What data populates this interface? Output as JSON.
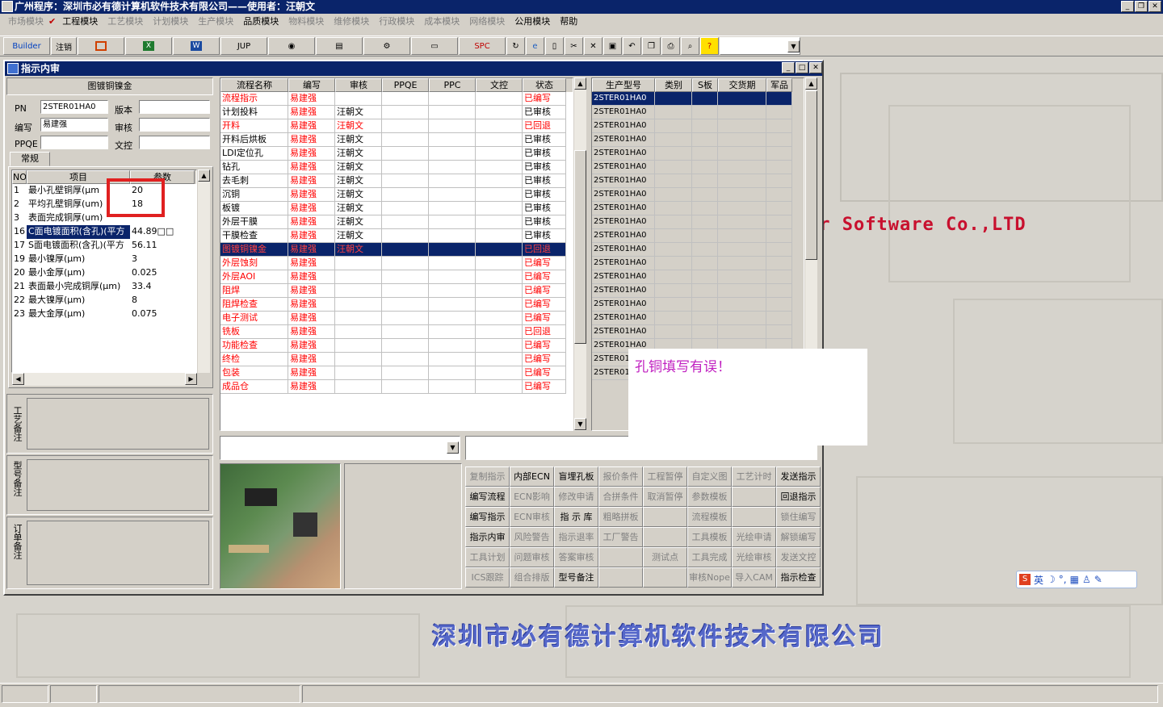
{
  "app": {
    "title": "广州程序：深圳市必有德计算机软件技术有限公司——使用者：汪朝文"
  },
  "menu": [
    {
      "label": "市场模块",
      "enabled": false
    },
    {
      "label": "工程模块",
      "enabled": true,
      "checked": true
    },
    {
      "label": "工艺模块",
      "enabled": false
    },
    {
      "label": "计划模块",
      "enabled": false
    },
    {
      "label": "生产模块",
      "enabled": false
    },
    {
      "label": "品质模块",
      "enabled": true
    },
    {
      "label": "物料模块",
      "enabled": false
    },
    {
      "label": "维修模块",
      "enabled": false
    },
    {
      "label": "行政模块",
      "enabled": false
    },
    {
      "label": "成本模块",
      "enabled": false
    },
    {
      "label": "网络模块",
      "enabled": false
    },
    {
      "label": "公用模块",
      "enabled": true
    },
    {
      "label": "帮助",
      "enabled": true
    }
  ],
  "toolbar": {
    "builder": "Builder",
    "logout": "注销",
    "jup": "JUP",
    "spc": "SPC"
  },
  "window": {
    "title": "指示内审"
  },
  "left": {
    "section_title": "图镀铜镍金",
    "pn_label": "PN",
    "pn_value": "2STER01HA0",
    "version_label": "版本",
    "version_value": "",
    "author_label": "编写",
    "author_value": "易建强",
    "review_label": "审核",
    "review_value": "",
    "ppqe_label": "PPQE",
    "ppqe_value": "",
    "wenkong_label": "文控",
    "wenkong_value": "",
    "tab": "常规",
    "param_headers": [
      "NO",
      "项目",
      "参数"
    ],
    "params": [
      [
        "1",
        "最小孔壁铜厚(μm",
        "20"
      ],
      [
        "2",
        "平均孔壁铜厚(um)",
        "18"
      ],
      [
        "3",
        "表面完成铜厚(um)",
        ""
      ],
      [
        "16",
        "C面电镀面积(含孔)(平方",
        "44.89□□"
      ],
      [
        "17",
        "S面电镀面积(含孔)(平方",
        "56.11"
      ],
      [
        "19",
        "最小镍厚(μm)",
        "3"
      ],
      [
        "20",
        "最小金厚(μm)",
        "0.025"
      ],
      [
        "21",
        "表面最小完成铜厚(μm)",
        "33.4"
      ],
      [
        "22",
        "最大镍厚(μm)",
        "8"
      ],
      [
        "23",
        "最大金厚(μm)",
        "0.075"
      ]
    ],
    "notes": [
      "工艺备注",
      "型号备注",
      "订单备注"
    ]
  },
  "flow": {
    "headers": [
      "流程名称",
      "编写",
      "审核",
      "PPQE",
      "PPC",
      "文控",
      "状态"
    ],
    "rows": [
      [
        "流程指示",
        "易建强",
        "",
        "",
        "",
        "",
        "已编写",
        "r"
      ],
      [
        "计划投料",
        "易建强",
        "汪朝文",
        "",
        "",
        "",
        "已审核",
        ""
      ],
      [
        "开料",
        "易建强",
        "汪朝文",
        "",
        "",
        "",
        "已回退",
        "r"
      ],
      [
        "开料后烘板",
        "易建强",
        "汪朝文",
        "",
        "",
        "",
        "已审核",
        ""
      ],
      [
        "LDI定位孔",
        "易建强",
        "汪朝文",
        "",
        "",
        "",
        "已审核",
        ""
      ],
      [
        "钻孔",
        "易建强",
        "汪朝文",
        "",
        "",
        "",
        "已审核",
        ""
      ],
      [
        "去毛刺",
        "易建强",
        "汪朝文",
        "",
        "",
        "",
        "已审核",
        ""
      ],
      [
        "沉铜",
        "易建强",
        "汪朝文",
        "",
        "",
        "",
        "已审核",
        ""
      ],
      [
        "板镀",
        "易建强",
        "汪朝文",
        "",
        "",
        "",
        "已审核",
        ""
      ],
      [
        "外层干膜",
        "易建强",
        "汪朝文",
        "",
        "",
        "",
        "已审核",
        ""
      ],
      [
        "干膜检查",
        "易建强",
        "汪朝文",
        "",
        "",
        "",
        "已审核",
        ""
      ],
      [
        "图镀铜镍金",
        "易建强",
        "汪朝文",
        "",
        "",
        "",
        "已回退",
        "s"
      ],
      [
        "外层蚀刻",
        "易建强",
        "",
        "",
        "",
        "",
        "已编写",
        "r"
      ],
      [
        "外层AOI",
        "易建强",
        "",
        "",
        "",
        "",
        "已编写",
        "r"
      ],
      [
        "阻焊",
        "易建强",
        "",
        "",
        "",
        "",
        "已编写",
        "r"
      ],
      [
        "阻焊检查",
        "易建强",
        "",
        "",
        "",
        "",
        "已编写",
        "r"
      ],
      [
        "电子测试",
        "易建强",
        "",
        "",
        "",
        "",
        "已编写",
        "r"
      ],
      [
        "铣板",
        "易建强",
        "",
        "",
        "",
        "",
        "已回退",
        "r"
      ],
      [
        "功能检查",
        "易建强",
        "",
        "",
        "",
        "",
        "已编写",
        "r"
      ],
      [
        "终检",
        "易建强",
        "",
        "",
        "",
        "",
        "已编写",
        "r"
      ],
      [
        "包装",
        "易建强",
        "",
        "",
        "",
        "",
        "已编写",
        "r"
      ],
      [
        "成品仓",
        "易建强",
        "",
        "",
        "",
        "",
        "已编写",
        "r"
      ]
    ]
  },
  "products": {
    "headers": [
      "生产型号",
      "类别",
      "S板",
      "交货期",
      "军品"
    ],
    "rows": [
      "2STER01HA0",
      "2STER01HA0",
      "2STER01HA0",
      "2STER01HA0",
      "2STER01HA0",
      "2STER01HA0",
      "2STER01HA0",
      "2STER01HA0",
      "2STER01HA0",
      "2STER01HA0",
      "2STER01HA0",
      "2STER01HA0",
      "2STER01HA0",
      "2STER01HA0",
      "2STER01HA0",
      "2STER01HA0",
      "2STER01HA0",
      "2STER01HA0",
      "2STER01HA0",
      "2STER01",
      "2STER01"
    ]
  },
  "buttons": [
    [
      "复制指示",
      false
    ],
    [
      "内部ECN",
      true
    ],
    [
      "盲埋孔板",
      true
    ],
    [
      "报价条件",
      false
    ],
    [
      "工程暂停",
      false
    ],
    [
      "自定义图",
      false
    ],
    [
      "工艺计时",
      false
    ],
    [
      "发送指示",
      true
    ],
    [
      "编写流程",
      true
    ],
    [
      "ECN影响",
      false
    ],
    [
      "修改申请",
      false
    ],
    [
      "合拼条件",
      false
    ],
    [
      "取消暂停",
      false
    ],
    [
      "参数模板",
      false
    ],
    [
      "",
      false
    ],
    [
      "回退指示",
      true
    ],
    [
      "编写指示",
      true
    ],
    [
      "ECN审核",
      false
    ],
    [
      "指 示 库",
      true
    ],
    [
      "粗略拼板",
      false
    ],
    [
      "",
      false
    ],
    [
      "流程模板",
      false
    ],
    [
      "",
      false
    ],
    [
      "锁住编写",
      false
    ],
    [
      "指示内审",
      true
    ],
    [
      "风险警告",
      false
    ],
    [
      "指示退率",
      false
    ],
    [
      "工厂警告",
      false
    ],
    [
      "",
      false
    ],
    [
      "工具模板",
      false
    ],
    [
      "光绘申请",
      false
    ],
    [
      "解锁编写",
      false
    ],
    [
      "工具计划",
      false
    ],
    [
      "问题审核",
      false
    ],
    [
      "答案审核",
      false
    ],
    [
      "",
      false
    ],
    [
      "测试点",
      false
    ],
    [
      "工具完成",
      false
    ],
    [
      "光绘审核",
      false
    ],
    [
      "发送文控",
      false
    ],
    [
      "ICS跟踪",
      false
    ],
    [
      "组合排版",
      false
    ],
    [
      "型号备注",
      true
    ],
    [
      "",
      false
    ],
    [
      "",
      false
    ],
    [
      "审核Nope",
      false
    ],
    [
      "导入CAM",
      false
    ],
    [
      "指示检查",
      true
    ]
  ],
  "popup": {
    "message": "孔铜填写有误！"
  },
  "brand": {
    "english": "er Software Co.,LTD",
    "chinese": "深圳市必有德计算机软件技术有限公司"
  },
  "ime": {
    "lang": "英"
  },
  "colors": {
    "titlebar": "#0a246a",
    "alert": "#ff0000",
    "popup_text": "#c020c0"
  }
}
